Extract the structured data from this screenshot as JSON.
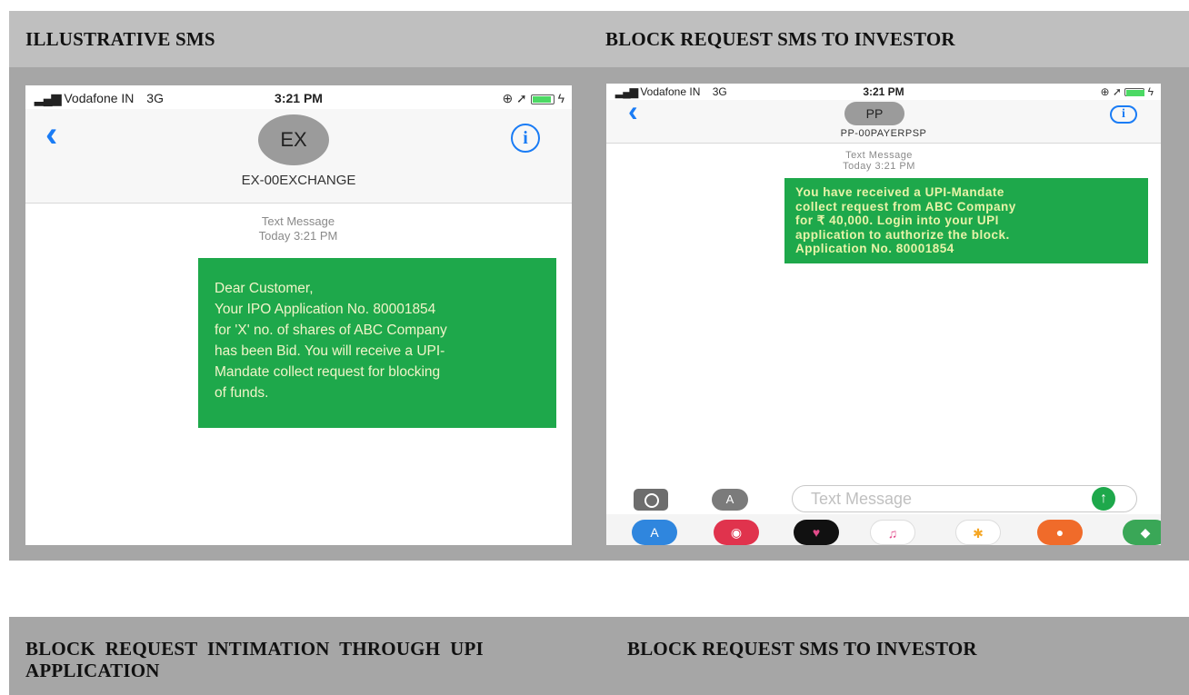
{
  "sections": {
    "top_left_title": "ILLUSTRATIVE SMS",
    "top_right_title": "BLOCK REQUEST SMS TO INVESTOR",
    "bottom_left_title": "BLOCK REQUEST INTIMATION THROUGH UPI APPLICATION",
    "bottom_left_title_line1": "BLOCK  REQUEST  INTIMATION  THROUGH  UPI",
    "bottom_left_title_line2": "APPLICATION",
    "bottom_right_title": "BLOCK REQUEST SMS TO INVESTOR"
  },
  "phone1": {
    "carrier": "Vodafone IN",
    "network": "3G",
    "time": "3:21 PM",
    "back_icon": "chevron-left-icon",
    "info_icon": "info-icon",
    "avatar_text": "EX",
    "contact_name": "EX-00EXCHANGE",
    "meta_label": "Text Message",
    "meta_time": "Today 3:21 PM",
    "message_lines": [
      "Dear Customer,",
      "Your IPO Application No. 80001854",
      "for 'X' no. of shares of ABC Company",
      "has been Bid. You will receive a UPI-",
      "Mandate collect request for blocking",
      "of funds."
    ],
    "bubble_color": "#1ea84b"
  },
  "phone2": {
    "carrier": "Vodafone IN",
    "network": "3G",
    "time": "3:21 PM",
    "back_icon": "chevron-left-icon",
    "info_icon": "info-icon",
    "avatar_text": "PP",
    "contact_name": "PP-00PAYERPSP",
    "meta_label": "Text Message",
    "meta_time": "Today 3:21 PM",
    "message_lines": [
      "You have received a UPI-Mandate",
      "collect request from ABC Company",
      "for ₹ 40,000. Login into your UPI",
      "application to authorize the block.",
      "Application No. 80001854"
    ],
    "input_placeholder": "Text Message",
    "bubble_color": "#1ea84b"
  }
}
